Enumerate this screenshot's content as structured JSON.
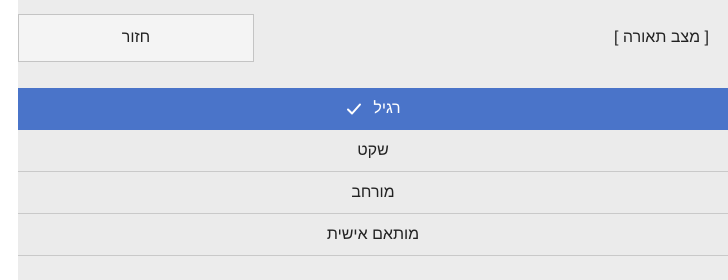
{
  "header": {
    "title": "[ מצב תאורה ]",
    "back_label": "חזור"
  },
  "options": [
    {
      "label": "רגיל",
      "selected": true,
      "icon": "check-icon"
    },
    {
      "label": "שקט",
      "selected": false
    },
    {
      "label": "מורחב",
      "selected": false
    },
    {
      "label": "מותאם אישית",
      "selected": false
    }
  ],
  "colors": {
    "panel": "#ececec",
    "selected": "#4a74c9",
    "text": "#222222",
    "selected_text": "#ffffff"
  }
}
